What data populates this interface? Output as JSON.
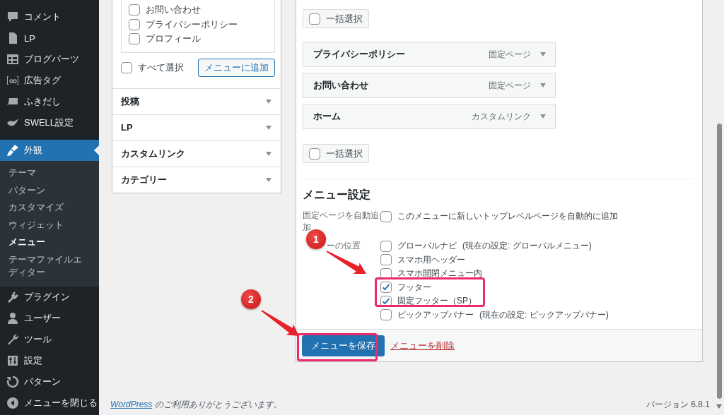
{
  "sidebar": {
    "items": [
      {
        "label": "コメント",
        "selected": false
      },
      {
        "label": "LP",
        "selected": false
      },
      {
        "label": "ブログパーツ",
        "selected": false
      },
      {
        "label": "広告タグ",
        "selected": false
      },
      {
        "label": "ふきだし",
        "selected": false
      },
      {
        "label": "SWELL設定",
        "selected": false
      },
      {
        "label": "外観",
        "selected": true,
        "children": [
          {
            "label": "テーマ",
            "selected": false
          },
          {
            "label": "パターン",
            "selected": false
          },
          {
            "label": "カスタマイズ",
            "selected": false
          },
          {
            "label": "ウィジェット",
            "selected": false
          },
          {
            "label": "メニュー",
            "selected": true
          },
          {
            "label": "テーマファイルエディター",
            "selected": false
          }
        ]
      },
      {
        "label": "プラグイン",
        "selected": false
      },
      {
        "label": "ユーザー",
        "selected": false
      },
      {
        "label": "ツール",
        "selected": false
      },
      {
        "label": "設定",
        "selected": false
      },
      {
        "label": "パターン",
        "selected": false
      },
      {
        "label": "メニューを閉じる",
        "selected": false
      }
    ]
  },
  "add_items": {
    "pages": [
      {
        "label": "お問い合わせ",
        "checked": false
      },
      {
        "label": "プライバシーポリシー",
        "checked": false
      },
      {
        "label": "プロフィール",
        "checked": false
      }
    ],
    "select_all": {
      "label": "すべて選択",
      "checked": false
    },
    "add_button": "メニューに追加",
    "sections": [
      {
        "title": "投稿",
        "expanded": false
      },
      {
        "title": "LP",
        "expanded": false
      },
      {
        "title": "カスタムリンク",
        "expanded": false
      },
      {
        "title": "カテゴリー",
        "expanded": false
      }
    ]
  },
  "menu_structure": {
    "bulk_select_top": {
      "label": "一括選択",
      "checked": false
    },
    "items": [
      {
        "title": "プライバシーポリシー",
        "type": "固定ページ"
      },
      {
        "title": "お問い合わせ",
        "type": "固定ページ"
      },
      {
        "title": "ホーム",
        "type": "カスタムリンク"
      }
    ],
    "bulk_select_bottom": {
      "label": "一括選択",
      "checked": false
    },
    "settings": {
      "heading": "メニュー設定",
      "auto_add": {
        "label": "固定ページを自動追加",
        "option": "このメニューに新しいトップレベルページを自動的に追加",
        "checked": false
      },
      "locations": {
        "label": "ーの位置",
        "options": [
          {
            "label": "グローバルナビ",
            "note": "(現在の設定: グローバルメニュー)",
            "checked": false
          },
          {
            "label": "スマホ用ヘッダー",
            "checked": false
          },
          {
            "label": "スマホ開閉メニュー内",
            "checked": false
          },
          {
            "label": "フッター",
            "checked": true
          },
          {
            "label": "固定フッター（SP）",
            "checked": true
          },
          {
            "label": "ピックアップバナー",
            "note": "(現在の設定: ピックアップバナー)",
            "checked": false
          }
        ]
      }
    },
    "save_button": "メニューを保存",
    "delete_link": "メニューを削除"
  },
  "footer": {
    "link": "WordPress",
    "thanks": " のご利用ありがとうございます。",
    "version": "バージョン 6.8.1"
  },
  "annotations": [
    {
      "number": "1"
    },
    {
      "number": "2"
    }
  ]
}
